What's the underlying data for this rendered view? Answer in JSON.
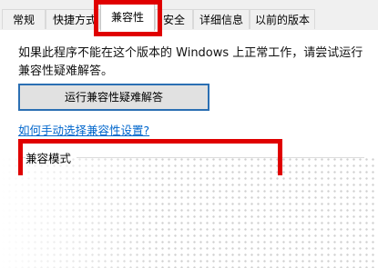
{
  "tabs": [
    {
      "label": "常规"
    },
    {
      "label": "快捷方式"
    },
    {
      "label": "兼容性"
    },
    {
      "label": "安全"
    },
    {
      "label": "详细信息"
    },
    {
      "label": "以前的版本"
    }
  ],
  "compat": {
    "description": "如果此程序不能在这个版本的 Windows 上正常工作，请尝试运行兼容性疑难解答。",
    "run_troubleshooter_button": "运行兼容性疑难解答",
    "manual_link": "如何手动选择兼容性设置?",
    "mode_group_label": "兼容模式"
  },
  "colors": {
    "highlight": "#e00000",
    "link": "#0066cc",
    "button_border": "#2b6fb3",
    "tab_background": "#f0f0f0"
  }
}
